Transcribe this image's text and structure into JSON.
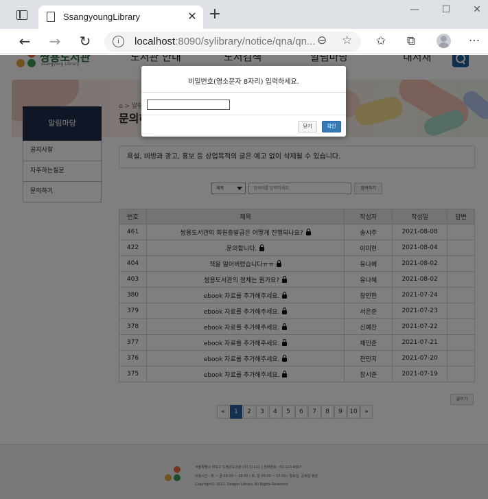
{
  "browser": {
    "tab_title": "SsangyoungLibrary",
    "url_host": "localhost",
    "url_rest": ":8090/sylibrary/notice/qna/qn..."
  },
  "site": {
    "logo_name": "쌍용도서관",
    "logo_sub": "ssangyong Library",
    "nav": [
      "도서관 안내",
      "도서검색",
      "알림마당",
      "내서재"
    ],
    "crumb": "알림",
    "page_title": "문의하기"
  },
  "sidebar": {
    "header": "알림마당",
    "items": [
      {
        "label": "공지사항"
      },
      {
        "label": "자주하는질문"
      },
      {
        "label": "문의하기"
      }
    ]
  },
  "notice_text": "욕설, 비방과 광고, 홍보 등 상업목적의 글은 예고 없이 삭제될 수 있습니다.",
  "search": {
    "select_value": "제목",
    "placeholder": "검색어를 입력하세요.",
    "button": "검색하기"
  },
  "board": {
    "columns": [
      "번호",
      "제목",
      "작성자",
      "작성일",
      "답변"
    ],
    "rows": [
      {
        "no": "461",
        "title": "쌍용도서관의 회원증발급은 어떻게 진행되나요?",
        "author": "송시주",
        "date": "2021-08-08",
        "answer": ""
      },
      {
        "no": "422",
        "title": "문의합니다.",
        "author": "이미현",
        "date": "2021-08-04",
        "answer": ""
      },
      {
        "no": "404",
        "title": "책을 잃어버렸습니다ㅠㅠ",
        "author": "유나혜",
        "date": "2021-08-02",
        "answer": ""
      },
      {
        "no": "403",
        "title": "쌍용도서관의 정체는 뭔가요?",
        "author": "유나혜",
        "date": "2021-08-02",
        "answer": ""
      },
      {
        "no": "380",
        "title": "ebook 자료를 추가해주세요.",
        "author": "장민한",
        "date": "2021-07-24",
        "answer": ""
      },
      {
        "no": "379",
        "title": "ebook 자료를 추가해주세요.",
        "author": "서은준",
        "date": "2021-07-23",
        "answer": ""
      },
      {
        "no": "378",
        "title": "ebook 자료를 추가해주세요.",
        "author": "신예찬",
        "date": "2021-07-22",
        "answer": ""
      },
      {
        "no": "377",
        "title": "ebook 자료를 추가해주세요.",
        "author": "채민준",
        "date": "2021-07-21",
        "answer": ""
      },
      {
        "no": "376",
        "title": "ebook 자료를 추가해주세요.",
        "author": "천민지",
        "date": "2021-07-20",
        "answer": ""
      },
      {
        "no": "375",
        "title": "ebook 자료를 추가해주세요.",
        "author": "장시준",
        "date": "2021-07-19",
        "answer": ""
      }
    ]
  },
  "write_button": "글쓰기",
  "pagination": {
    "prev": "«",
    "pages": [
      "1",
      "2",
      "3",
      "4",
      "5",
      "6",
      "7",
      "8",
      "9",
      "10"
    ],
    "current": "1",
    "next": "»"
  },
  "footer": {
    "line1": "서울특별시 마포구 드래곤도서관 (우) 11111 | 전화번호 : 02-123-4567",
    "line2": "이용시간 : 화 ~ 금 09:00 ~ 18:00 / 토, 일 09:00 ~ 17:00 / 월요일, 공휴일 휴관",
    "line3": "Copyright© 2021. Dragon Library. All Rights Reserved."
  },
  "dialog": {
    "message": "비밀번호(영소문자 8자리) 입력하세요.",
    "input_value": "",
    "cancel": "닫기",
    "ok": "확인"
  },
  "colors": {
    "accent": "#337ab7",
    "sidebar_header": "#1f2f4f",
    "active_page": "#2a62a4"
  }
}
